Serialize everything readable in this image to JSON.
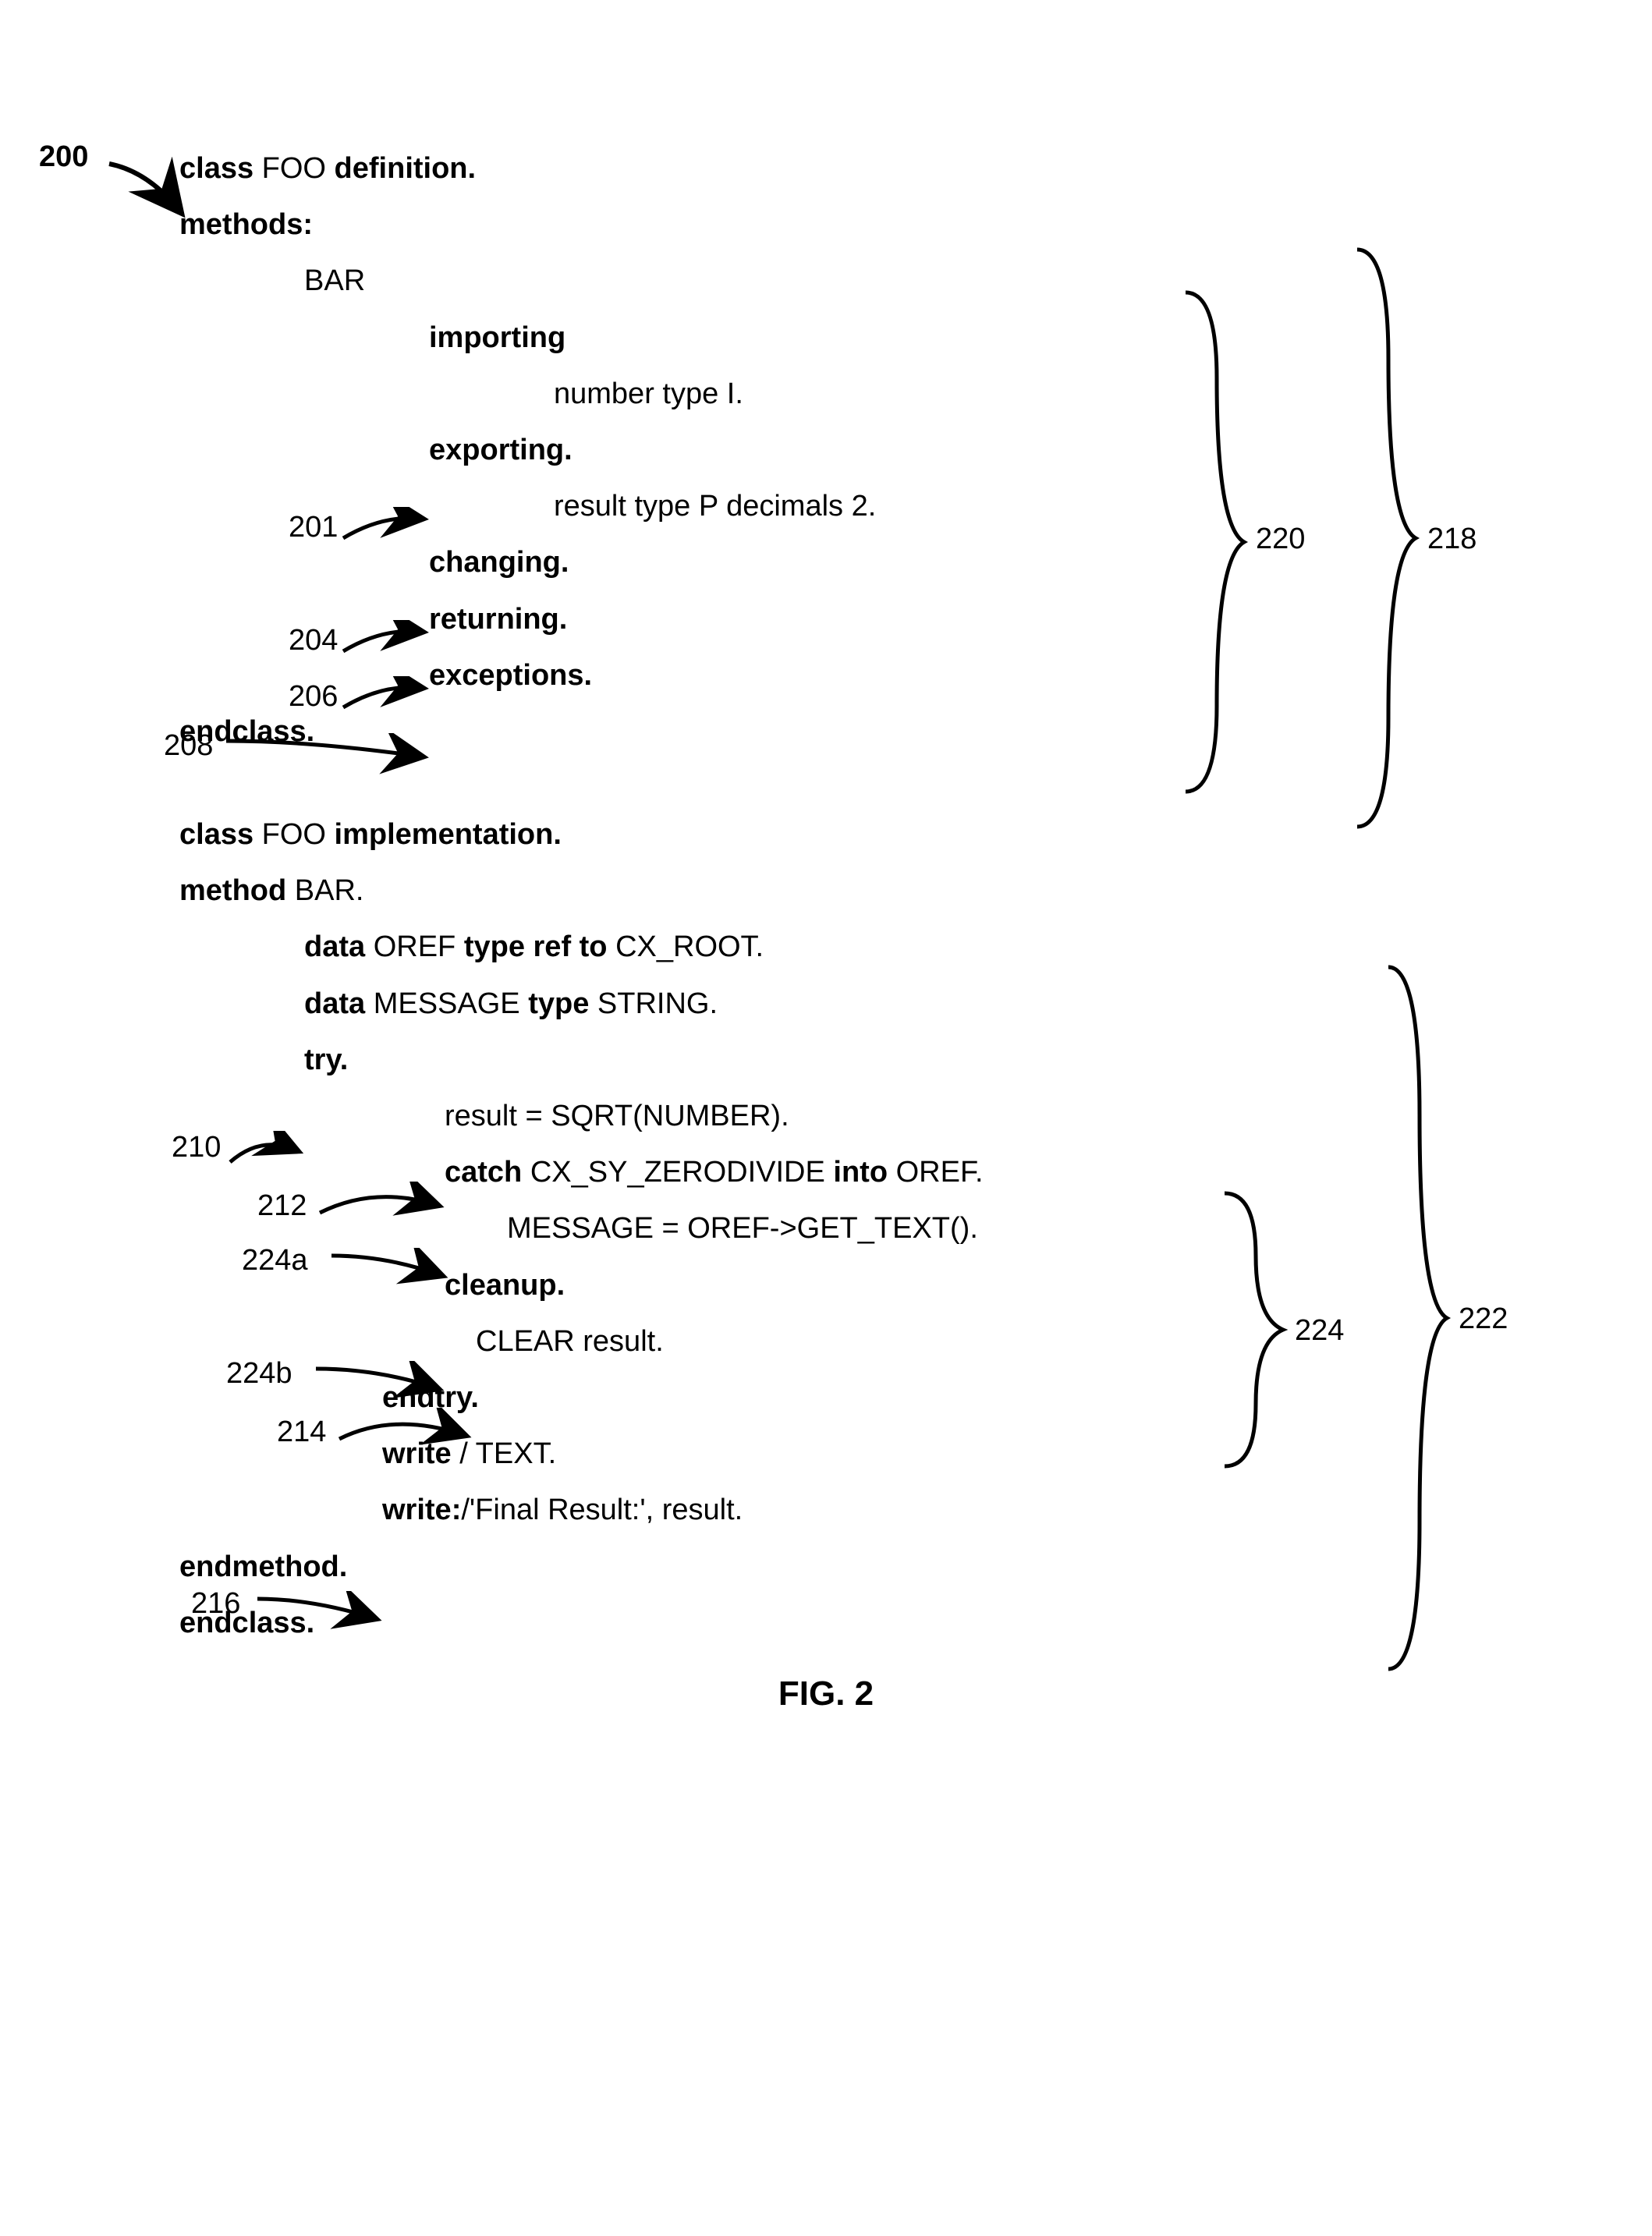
{
  "figureRef": "200",
  "figureLabel": "FIG. 2",
  "callouts": {
    "c201": "201",
    "c204": "204",
    "c206": "206",
    "c208": "208",
    "c210": "210",
    "c212": "212",
    "c214": "214",
    "c216": "216",
    "c218": "218",
    "c220": "220",
    "c222": "222",
    "c224": "224",
    "c224a": "224a",
    "c224b": "224b"
  },
  "code": {
    "l1a": "class ",
    "l1b": "FOO ",
    "l1c": "definition.",
    "l2": "methods:",
    "l3": "BAR",
    "l4": "importing",
    "l5": "number type I.",
    "l6": "exporting.",
    "l7": "result type P decimals 2.",
    "l8": "changing.",
    "l9": "returning.",
    "l10": "exceptions.",
    "l11": "endclass.",
    "l12a": "class ",
    "l12b": "FOO ",
    "l12c": "implementation.",
    "l13a": "method ",
    "l13b": "BAR.",
    "l14a": "data ",
    "l14b": "OREF ",
    "l14c": "type ref to ",
    "l14d": "CX_ROOT.",
    "l15a": "data ",
    "l15b": "MESSAGE ",
    "l15c": "type ",
    "l15d": "STRING.",
    "l16": "try.",
    "l17": "result = SQRT(NUMBER).",
    "l18a": "catch ",
    "l18b": "CX_SY_ZERODIVIDE ",
    "l18c": "into ",
    "l18d": "OREF.",
    "l19": "MESSAGE = OREF->GET_TEXT().",
    "l20": "cleanup.",
    "l21": "CLEAR result.",
    "l22": "endtry.",
    "l23a": "write ",
    "l23b": "/ TEXT.",
    "l24a": "write:",
    "l24b": "/'Final Result:', result.",
    "l25": "endmethod.",
    "l26": "endclass."
  }
}
